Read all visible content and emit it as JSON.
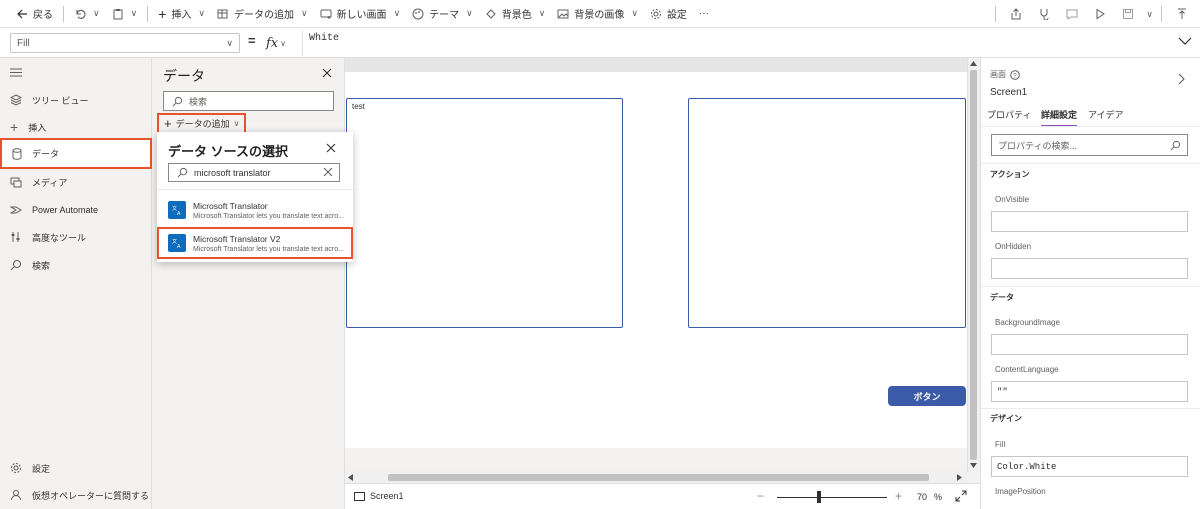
{
  "toolbar": {
    "back_label": "戻る",
    "insert_label": "挿入",
    "add_data_label": "データの追加",
    "new_screen_label": "新しい画面",
    "theme_label": "テーマ",
    "background_color_label": "背景色",
    "background_image_label": "背景の画像",
    "settings_label": "設定",
    "more_label": "···"
  },
  "formula_bar": {
    "property": "Fill",
    "equals": "=",
    "fx": "fx",
    "formula": "White"
  },
  "left_nav": {
    "items": [
      {
        "label": "ツリー ビュー",
        "icon": "layers-icon"
      },
      {
        "label": "挿入",
        "icon": "plus-icon"
      },
      {
        "label": "データ",
        "icon": "database-icon"
      },
      {
        "label": "メディア",
        "icon": "media-icon"
      },
      {
        "label": "Power Automate",
        "icon": "power-automate-icon"
      },
      {
        "label": "高度なツール",
        "icon": "tools-icon"
      },
      {
        "label": "検索",
        "icon": "search-icon"
      }
    ],
    "bottom": [
      {
        "label": "設定",
        "icon": "gear-icon"
      },
      {
        "label": "仮想オペレーターに質問する",
        "icon": "agent-icon"
      }
    ]
  },
  "data_panel": {
    "title": "データ",
    "search_placeholder": "検索",
    "add_data_label": "データの追加"
  },
  "flyout": {
    "title": "データ ソースの選択",
    "search_value": "microsoft translator",
    "connectors": [
      {
        "name": "Microsoft Translator",
        "description": "Microsoft Translator lets you translate text acro..."
      },
      {
        "name": "Microsoft Translator V2",
        "description": "Microsoft Translator lets you translate text acro..."
      }
    ]
  },
  "canvas": {
    "textbox1_text": "test",
    "button_label": "ボタン"
  },
  "status_bar": {
    "screen_name": "Screen1",
    "zoom_minus": "−",
    "zoom_plus": "+",
    "zoom_value": "70",
    "zoom_unit": "%"
  },
  "properties": {
    "type_label": "画面",
    "screen_name": "Screen1",
    "tabs": [
      "プロパティ",
      "詳細設定",
      "アイデア"
    ],
    "search_placeholder": "プロパティの検索...",
    "sections": {
      "action": "アクション",
      "data": "データ",
      "design": "デザイン"
    },
    "fields": {
      "on_visible": {
        "label": "OnVisible",
        "value": ""
      },
      "on_hidden": {
        "label": "OnHidden",
        "value": ""
      },
      "background_image": {
        "label": "BackgroundImage",
        "value": ""
      },
      "content_language": {
        "label": "ContentLanguage",
        "value": "\"\""
      },
      "fill": {
        "label": "Fill",
        "value": "Color.White"
      },
      "image_position": {
        "label": "ImagePosition",
        "value": ""
      }
    }
  },
  "colors": {
    "highlight": "#e8532d",
    "accent": "#3b5aa8",
    "connector": "#0f6cbd"
  }
}
